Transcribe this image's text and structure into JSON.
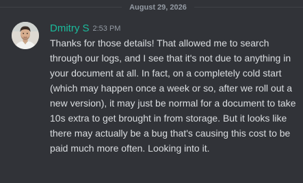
{
  "divider": {
    "date": "August 29, 2026"
  },
  "message": {
    "author": "Dmitry S",
    "timestamp": "2:53 PM",
    "author_color": "#1abc9c",
    "avatar_icon": "user-avatar-photo",
    "text": "Thanks for those details! That allowed me to search through our logs, and I see that it's not due to anything in your document at all. In fact, on a completely cold start (which may happen once a week or so, after we roll out a new version), it may just be normal for a document to take 10s extra to get brought in from storage. But it looks like there may actually be a bug that's causing this cost to be paid much more often. Looking into it."
  }
}
